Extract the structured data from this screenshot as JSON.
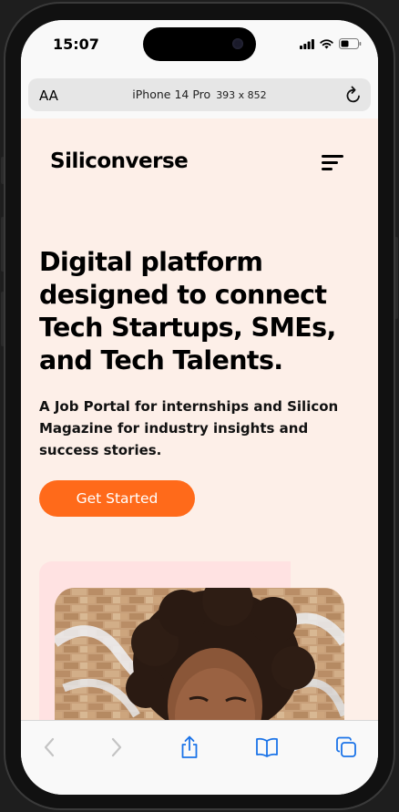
{
  "status_bar": {
    "time": "15:07"
  },
  "browser": {
    "text_size_label": "AA",
    "device_name": "iPhone 14 Pro",
    "device_dims": "393 x 852"
  },
  "header": {
    "logo": "Siliconverse"
  },
  "hero": {
    "headline": "Digital platform designed to connect Tech Startups, SMEs, and Tech Talents.",
    "subheadline": "A Job Portal for internships and Silicon Magazine for industry insights and success stories.",
    "cta_label": "Get Started"
  },
  "colors": {
    "page_background": "#fdefe8",
    "accent": "#ff6a1a",
    "photo_backdrop": "#ffe2e2",
    "toolbar_icon": "#1a73e8",
    "toolbar_disabled": "#c4c4c4"
  },
  "toolbar": {
    "icons": [
      "back-icon",
      "forward-icon",
      "share-icon",
      "bookmarks-icon",
      "tabs-icon"
    ]
  }
}
